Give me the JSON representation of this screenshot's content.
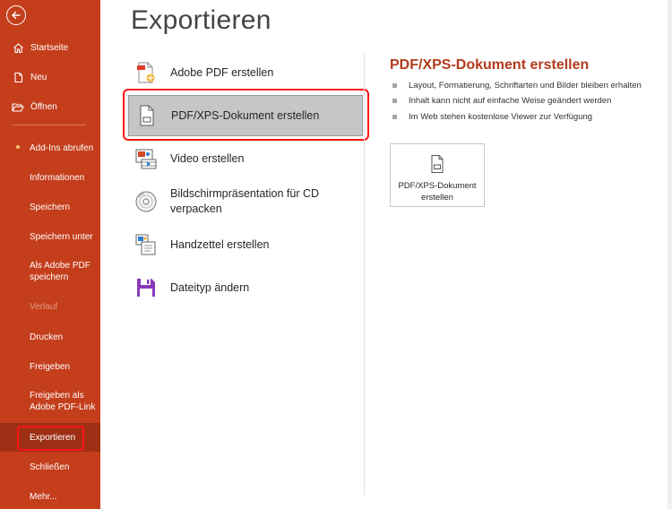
{
  "sidebar": {
    "items": [
      {
        "label": "Startseite"
      },
      {
        "label": "Neu"
      },
      {
        "label": "Öffnen"
      },
      {
        "label": "Add-Ins abrufen"
      },
      {
        "label": "Informationen"
      },
      {
        "label": "Speichern"
      },
      {
        "label": "Speichern unter"
      },
      {
        "label": "Als Adobe PDF speichern"
      },
      {
        "label": "Verlauf"
      },
      {
        "label": "Drucken"
      },
      {
        "label": "Freigeben"
      },
      {
        "label": "Freigeben als Adobe PDF-Link"
      },
      {
        "label": "Exportieren"
      },
      {
        "label": "Schließen"
      },
      {
        "label": "Mehr..."
      }
    ]
  },
  "main": {
    "title": "Exportieren",
    "options": [
      {
        "label": "Adobe PDF erstellen",
        "icon": "adobe-pdf-icon"
      },
      {
        "label": "PDF/XPS-Dokument erstellen",
        "icon": "pdf-document-icon"
      },
      {
        "label": "Video erstellen",
        "icon": "video-icon"
      },
      {
        "label": "Bildschirmpräsentation für CD verpacken",
        "icon": "cd-icon"
      },
      {
        "label": "Handzettel erstellen",
        "icon": "handout-icon"
      },
      {
        "label": "Dateityp ändern",
        "icon": "save-as-icon"
      }
    ]
  },
  "detail": {
    "title": "PDF/XPS-Dokument erstellen",
    "bullets": [
      "Layout, Formatierung, Schriftarten und Bilder bleiben erhalten",
      "Inhalt kann nicht auf einfache Weise geändert werden",
      "Im Web stehen kostenlose Viewer zur Verfügung"
    ],
    "button_label": "PDF/XPS-Dokument erstellen"
  },
  "colors": {
    "sidebar_bg": "#c43e1c",
    "accent_title": "#b33b1d",
    "highlight_border": "#ff1414",
    "selected_option_bg": "#c6c6c6"
  }
}
